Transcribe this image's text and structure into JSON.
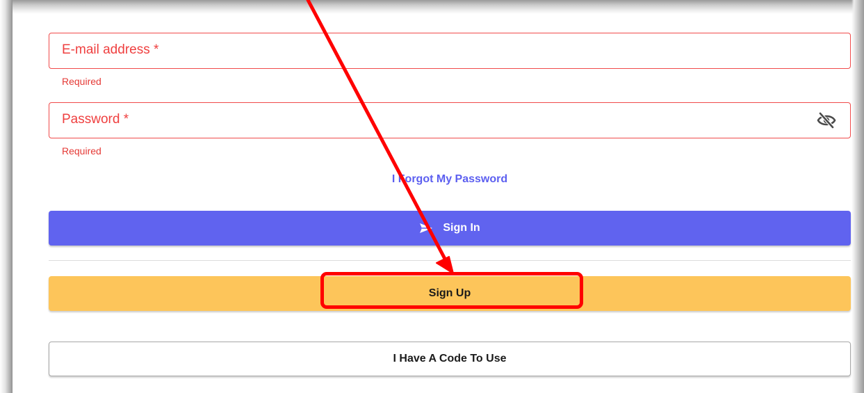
{
  "form": {
    "email_label": "E-mail address *",
    "email_helper": "Required",
    "password_label": "Password *",
    "password_helper": "Required",
    "forgot_link": "I Forgot My Password",
    "signin_label": "Sign In",
    "signup_label": "Sign Up",
    "code_label": "I Have A Code To Use"
  },
  "icons": {
    "password_toggle": "eye-off-icon",
    "signin": "send-icon"
  },
  "colors": {
    "error": "#ef3f3f",
    "primary": "#6063ef",
    "accent": "#fdc55a",
    "annotation": "#ff0000"
  }
}
